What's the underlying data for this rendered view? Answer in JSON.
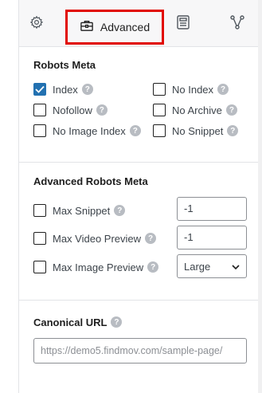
{
  "tabs": {
    "settings_icon": "gear-icon",
    "advanced_label": "Advanced",
    "schema_icon": "document-icon",
    "social_icon": "share-nodes-icon",
    "highlight_color": "#e10600"
  },
  "robots_meta": {
    "title": "Robots Meta",
    "options": [
      {
        "label": "Index",
        "checked": true
      },
      {
        "label": "No Index",
        "checked": false
      },
      {
        "label": "Nofollow",
        "checked": false
      },
      {
        "label": "No Archive",
        "checked": false
      },
      {
        "label": "No Image Index",
        "checked": false
      },
      {
        "label": "No Snippet",
        "checked": false
      }
    ]
  },
  "advanced_robots": {
    "title": "Advanced Robots Meta",
    "max_snippet": {
      "label": "Max Snippet",
      "value": "-1",
      "checked": false
    },
    "max_video_preview": {
      "label": "Max Video Preview",
      "value": "-1",
      "checked": false
    },
    "max_image_preview": {
      "label": "Max Image Preview",
      "value": "Large",
      "checked": false
    }
  },
  "canonical": {
    "title": "Canonical URL",
    "placeholder": "https://demo5.findmov.com/sample-page/"
  },
  "colors": {
    "accent": "#2271b1",
    "help_icon": "#b8bcc2"
  }
}
